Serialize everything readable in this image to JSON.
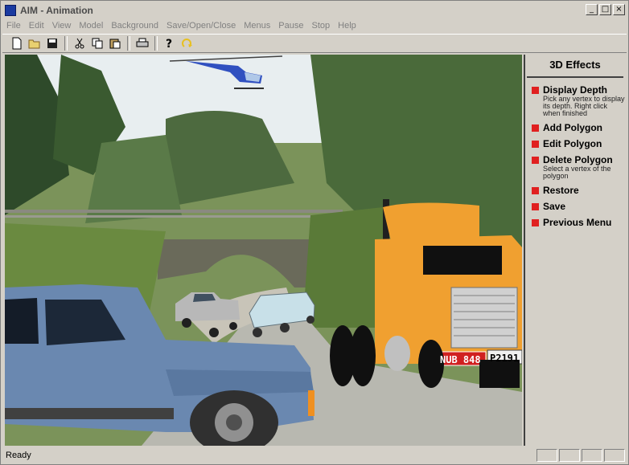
{
  "window": {
    "title": "AIM - Animation"
  },
  "window_buttons": {
    "minimize": "_",
    "maximize": "□",
    "close": "×"
  },
  "menu": [
    "File",
    "Edit",
    "View",
    "Model",
    "Background",
    "Save/Open/Close",
    "Menus",
    "Pause",
    "Stop",
    "Help"
  ],
  "toolbar_icons": [
    "new-icon",
    "open-icon",
    "save-icon",
    "cut-icon",
    "copy-icon",
    "paste-icon",
    "print-icon",
    "help-icon",
    "redo-icon"
  ],
  "panel": {
    "title": "3D Effects",
    "items": [
      {
        "label": "Display Depth",
        "desc": "Pick any vertex to display its depth. Right click when finished"
      },
      {
        "label": "Add Polygon",
        "desc": ""
      },
      {
        "label": "Edit Polygon",
        "desc": ""
      },
      {
        "label": "Delete Polygon",
        "desc": "Select a vertex of the polygon"
      },
      {
        "label": "Restore",
        "desc": ""
      },
      {
        "label": "Save",
        "desc": ""
      },
      {
        "label": "Previous Menu",
        "desc": ""
      }
    ]
  },
  "scene": {
    "truck_plate_left": "NUB 848",
    "truck_plate_right": "P2191"
  },
  "status": {
    "text": "Ready"
  },
  "colors": {
    "accent_red": "#e02020",
    "truck_orange": "#f0a030",
    "jeep_blue": "#6a88b0"
  }
}
